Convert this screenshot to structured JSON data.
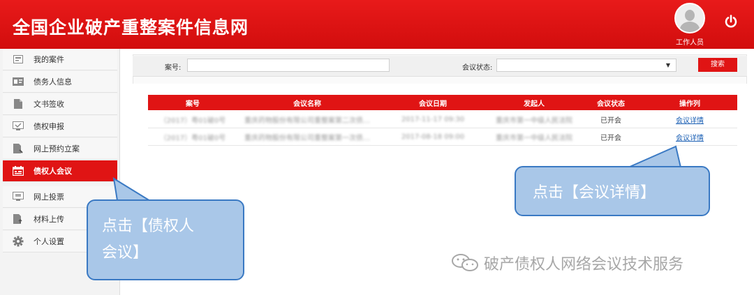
{
  "header": {
    "site_title": "全国企业破产重整案件信息网",
    "user_label": "工作人员",
    "power_icon": "power-icon",
    "accent_color": "#e01414"
  },
  "sidebar": {
    "items": [
      {
        "label": "我的案件",
        "icon": "folder-icon",
        "active": false
      },
      {
        "label": "债务人信息",
        "icon": "id-card-icon",
        "active": false
      },
      {
        "label": "文书签收",
        "icon": "document-icon",
        "active": false
      },
      {
        "label": "债权申报",
        "icon": "monitor-check-icon",
        "active": false
      },
      {
        "label": "网上预约立案",
        "icon": "document-edit-icon",
        "active": false
      },
      {
        "label": "债权人会议",
        "icon": "calendar-icon",
        "active": true
      },
      {
        "label": "网上投票",
        "icon": "monitor-icon",
        "active": false
      },
      {
        "label": "材料上传",
        "icon": "upload-doc-icon",
        "active": false
      },
      {
        "label": "个人设置",
        "icon": "gear-icon",
        "active": false
      }
    ]
  },
  "search": {
    "case_label": "案号:",
    "case_value": "",
    "status_label": "会议状态:",
    "status_value": "",
    "search_button": "搜索"
  },
  "table": {
    "columns": [
      "案号",
      "会议名称",
      "会议日期",
      "发起人",
      "会议状态",
      "操作列"
    ],
    "rows": [
      [
        "（2017）粤01破0号",
        "重庆药物股份有限公司重整案第二次债…",
        "2017-11-17 09:30",
        "重庆市第一中级人民法院",
        "已开会",
        "会议详情"
      ],
      [
        "（2017）粤01破0号",
        "重庆药物股份有限公司重整案第一次债…",
        "2017-08-18 09:00",
        "重庆市第一中级人民法院",
        "已开会",
        "会议详情"
      ]
    ]
  },
  "callouts": {
    "right_text": "点击【会议详情】",
    "left_line1": "点击【债权人",
    "left_line2": "会议】",
    "callout_fill": "#a9c7e8",
    "callout_border": "#3a79c3"
  },
  "watermark": {
    "text": "破产债权人网络会议技术服务",
    "icon": "wechat-icon"
  }
}
